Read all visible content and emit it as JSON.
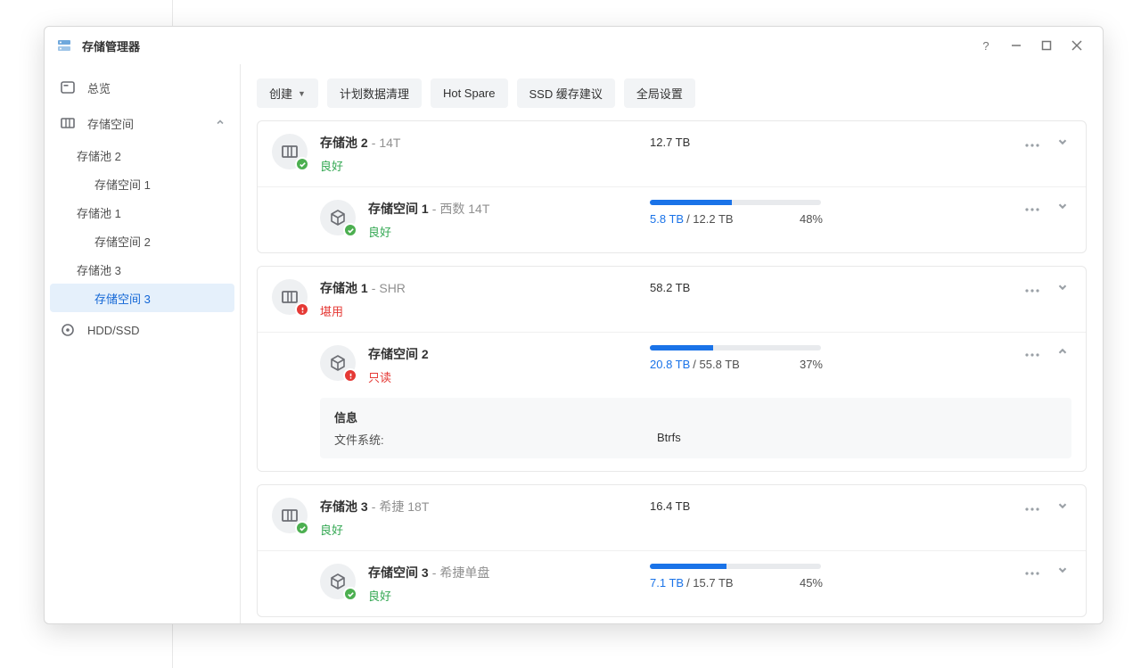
{
  "title": "存储管理器",
  "titlebar": {
    "help": "?"
  },
  "sidebar": {
    "overview": "总览",
    "storage": "存储空间",
    "hdd": "HDD/SSD",
    "tree": [
      {
        "pool": "存储池 2",
        "vol": "存储空间 1"
      },
      {
        "pool": "存储池 1",
        "vol": "存储空间 2"
      },
      {
        "pool": "存储池 3",
        "vol": "存储空间 3"
      }
    ]
  },
  "toolbar": {
    "create": "创建",
    "scrub": "计划数据清理",
    "hotspare": "Hot Spare",
    "ssdcache": "SSD 缓存建议",
    "global": "全局设置"
  },
  "pools": [
    {
      "name": "存储池 2",
      "sub": "14T",
      "status": "良好",
      "status_class": "ok",
      "size": "12.7 TB",
      "volumes": [
        {
          "name": "存储空间 1",
          "sub": "西数 14T",
          "status": "良好",
          "status_class": "ok",
          "used": "5.8 TB",
          "total": "12.2 TB",
          "pct": "48%",
          "bar_pct": 48
        }
      ]
    },
    {
      "name": "存储池 1",
      "sub": "SHR",
      "status": "堪用",
      "status_class": "warn",
      "size": "58.2 TB",
      "volumes": [
        {
          "name": "存储空间 2",
          "sub": "",
          "status": "只读",
          "status_class": "warn",
          "used": "20.8 TB",
          "total": "55.8 TB",
          "pct": "37%",
          "bar_pct": 37,
          "expanded": true,
          "info": {
            "title": "信息",
            "fs_label": "文件系统:",
            "fs_value": "Btrfs"
          }
        }
      ]
    },
    {
      "name": "存储池 3",
      "sub": "希捷 18T",
      "status": "良好",
      "status_class": "ok",
      "size": "16.4 TB",
      "volumes": [
        {
          "name": "存储空间 3",
          "sub": "希捷单盘",
          "status": "良好",
          "status_class": "ok",
          "used": "7.1 TB",
          "total": "15.7 TB",
          "pct": "45%",
          "bar_pct": 45
        }
      ]
    }
  ]
}
